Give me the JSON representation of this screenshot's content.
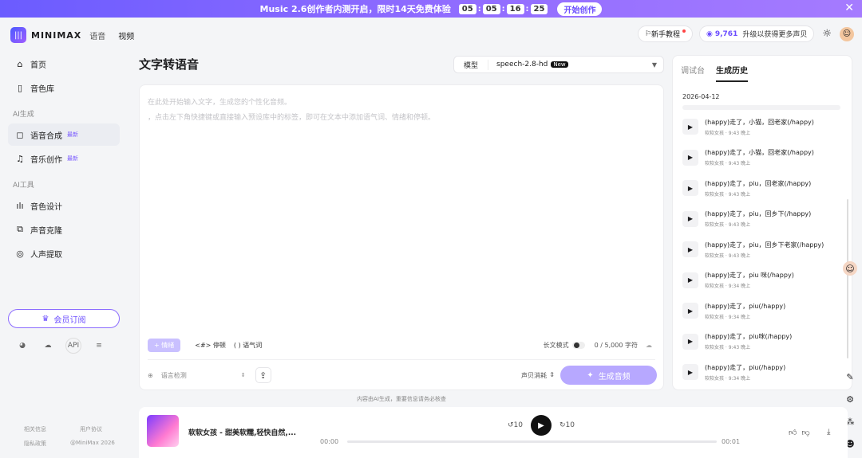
{
  "banner": {
    "text": "Music 2.6创作者内测开启，限时14天免费体验",
    "timer": [
      "05",
      "05",
      "16",
      "25"
    ],
    "cta": "开始创作"
  },
  "header": {
    "brand": "MINIMAX",
    "tabs": [
      "语音",
      "视频"
    ],
    "tutorial": "新手教程",
    "credits": "9,761",
    "upgrade": "升级以获得更多声贝"
  },
  "sidebar": {
    "home": "首页",
    "voice_library": "音色库",
    "group_ai_gen": "AI生成",
    "tts": "语音合成",
    "tts_badge": "最新",
    "music": "音乐创作",
    "music_badge": "最新",
    "group_ai_tools": "AI工具",
    "voice_design": "音色设计",
    "voice_clone": "声音克隆",
    "vocal_extract": "人声提取",
    "vip": "会员订阅",
    "api": "API",
    "footer": [
      "相关信息",
      "用户协议",
      "隐私政策",
      "@MiniMax 2026"
    ]
  },
  "main": {
    "title": "文字转语音",
    "model_label": "模型",
    "model_value": "speech-2.8-hd",
    "model_badge": "New",
    "placeholder1": "在此处开始输入文字，生成您的个性化音频。",
    "placeholder2": "，点击左下角快捷键或直接输入预设库中的标签，即可在文本中添加语气词、情绪和停顿。",
    "emotion_btn": "+ 情绪",
    "pause_tool": "<#> 停顿",
    "tone_tool": "( ) 语气词",
    "long_text": "长文模式",
    "char_count": "0 / 5,000 字符",
    "lang_detect": "语言检测",
    "voice_cost": "声贝消耗",
    "generate": "生成音频",
    "disclaimer": "内容由AI生成，重要信息请务必核查"
  },
  "history": {
    "tabs": [
      "调试台",
      "生成历史"
    ],
    "date": "2026-04-12",
    "items": [
      {
        "text": "(happy)走了，小猫，回老家(/happy)",
        "meta": "软软女孩 · 9:43 晚上"
      },
      {
        "text": "(happy)走了，小猫，回老家(/happy)",
        "meta": "软软女孩 · 9:43 晚上"
      },
      {
        "text": "(happy)走了，piu，回老家(/happy)",
        "meta": "软软女孩 · 9:43 晚上"
      },
      {
        "text": "(happy)走了，piu，回乡下(/happy)",
        "meta": "软软女孩 · 9:43 晚上"
      },
      {
        "text": "(happy)走了，piu，回乡下老家(/happy)",
        "meta": "软软女孩 · 9:43 晚上"
      },
      {
        "text": "(happy)走了，piu 咪(/happy)",
        "meta": "软软女孩 · 9:34 晚上"
      },
      {
        "text": "(happy)走了，piu(/happy)",
        "meta": "软软女孩 · 9:34 晚上"
      },
      {
        "text": "(happy)走了，piu咪(/happy)",
        "meta": "软软女孩 · 9:43 晚上"
      },
      {
        "text": "(happy)走了，piu(/happy)",
        "meta": "软软女孩 · 9:34 晚上"
      }
    ]
  },
  "player": {
    "title": "软软女孩 - 甜美软糯,轻快自然,...",
    "current": "00:00",
    "total": "00:01",
    "skip": "10",
    "progress": 0.0
  },
  "colors": {
    "accent": "#6b4dff",
    "generate_btn": "#b7a8ff"
  }
}
